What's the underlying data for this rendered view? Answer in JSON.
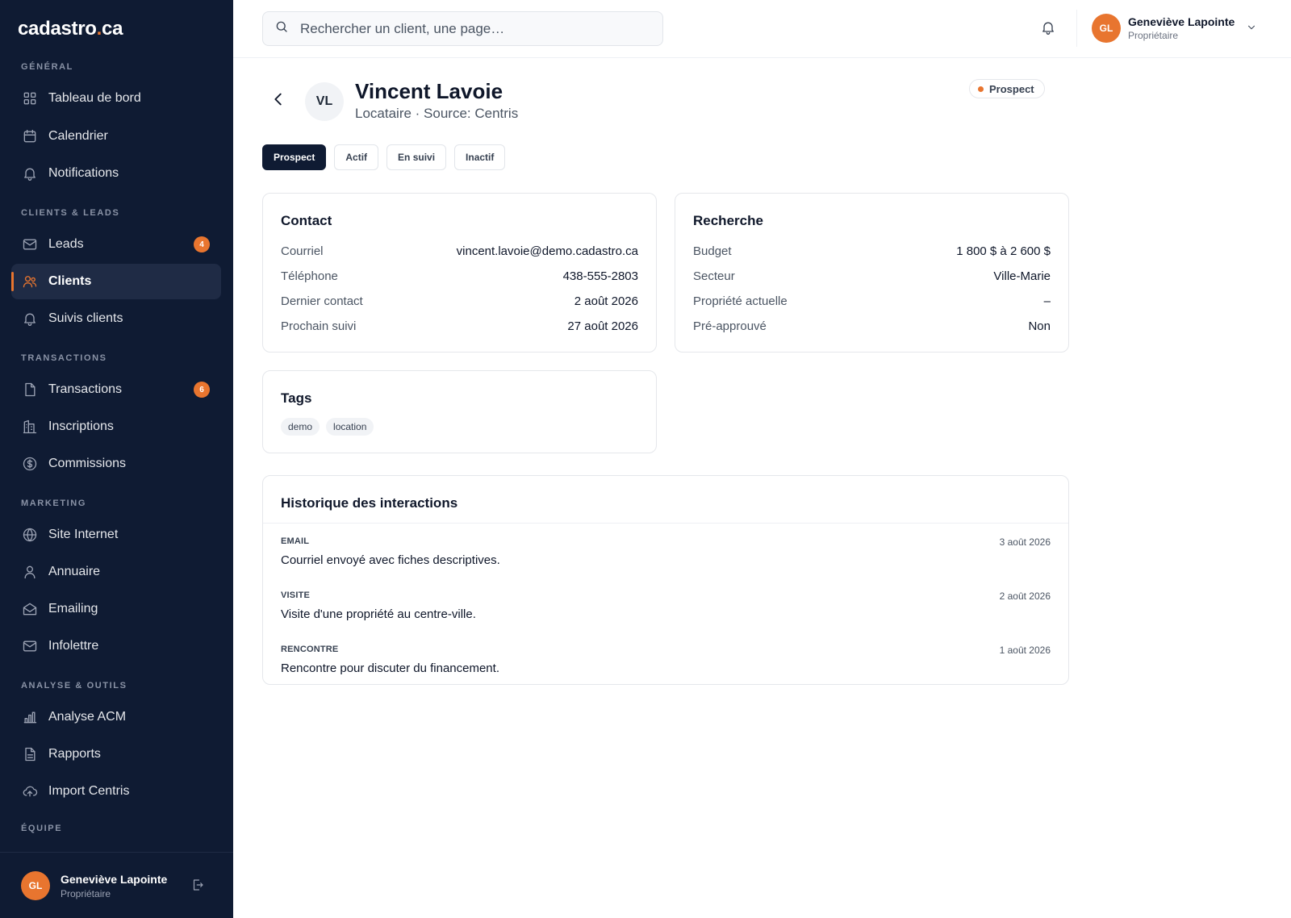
{
  "brand": {
    "name": "cadastro",
    "dot": ".",
    "tld": "ca",
    "accent": "#e8752f",
    "sidebar_bg": "#0f1b33"
  },
  "sidebar": {
    "sections": [
      {
        "label": "GÉNÉRAL"
      },
      {
        "label": "CLIENTS & LEADS"
      },
      {
        "label": "TRANSACTIONS"
      },
      {
        "label": "MARKETING"
      },
      {
        "label": "ANALYSE & OUTILS"
      },
      {
        "label": "ÉQUIPE"
      }
    ],
    "items": [
      {
        "label": "Tableau de bord",
        "icon": "grid-icon"
      },
      {
        "label": "Calendrier",
        "icon": "calendar-icon"
      },
      {
        "label": "Notifications",
        "icon": "bell-icon"
      },
      {
        "label": "Leads",
        "icon": "mail-icon",
        "badge": "4"
      },
      {
        "label": "Clients",
        "icon": "users-icon",
        "active": true
      },
      {
        "label": "Suivis clients",
        "icon": "bell-icon"
      },
      {
        "label": "Transactions",
        "icon": "file-icon",
        "badge": "6"
      },
      {
        "label": "Inscriptions",
        "icon": "building-icon"
      },
      {
        "label": "Commissions",
        "icon": "dollar-icon"
      },
      {
        "label": "Site Internet",
        "icon": "globe-icon"
      },
      {
        "label": "Annuaire",
        "icon": "person-icon"
      },
      {
        "label": "Emailing",
        "icon": "mail-open-icon"
      },
      {
        "label": "Infolettre",
        "icon": "mail-icon"
      },
      {
        "label": "Analyse ACM",
        "icon": "bar-chart-icon"
      },
      {
        "label": "Rapports",
        "icon": "report-icon"
      },
      {
        "label": "Import Centris",
        "icon": "cloud-upload-icon"
      }
    ],
    "user": {
      "initials": "GL",
      "name": "Geneviève Lapointe",
      "role": "Propriétaire"
    }
  },
  "topbar": {
    "search_placeholder": "Rechercher un client, une page…",
    "user": {
      "initials": "GL",
      "name": "Geneviève Lapointe",
      "role": "Propriétaire"
    }
  },
  "client": {
    "initials": "VL",
    "name": "Vincent Lavoie",
    "subtitle": "Locataire · Source: Centris",
    "status": "Prospect",
    "status_tabs": [
      {
        "label": "Prospect",
        "active": true
      },
      {
        "label": "Actif"
      },
      {
        "label": "En suivi"
      },
      {
        "label": "Inactif"
      }
    ]
  },
  "contact": {
    "title": "Contact",
    "rows": [
      {
        "k": "Courriel",
        "v": "vincent.lavoie@demo.cadastro.ca"
      },
      {
        "k": "Téléphone",
        "v": "438-555-2803"
      },
      {
        "k": "Dernier contact",
        "v": "2 août 2026"
      },
      {
        "k": "Prochain suivi",
        "v": "27 août 2026"
      }
    ]
  },
  "recherche": {
    "title": "Recherche",
    "rows": [
      {
        "k": "Budget",
        "v": "1 800 $ à 2 600 $"
      },
      {
        "k": "Secteur",
        "v": "Ville-Marie"
      },
      {
        "k": "Propriété actuelle",
        "v": "–"
      },
      {
        "k": "Pré-approuvé",
        "v": "Non"
      }
    ]
  },
  "tags": {
    "title": "Tags",
    "items": [
      "demo",
      "location"
    ]
  },
  "historique": {
    "title": "Historique des interactions",
    "items": [
      {
        "type": "EMAIL",
        "date": "3 août 2026",
        "text": "Courriel envoyé avec fiches descriptives."
      },
      {
        "type": "VISITE",
        "date": "2 août 2026",
        "text": "Visite d'une propriété au centre-ville."
      },
      {
        "type": "RENCONTRE",
        "date": "1 août 2026",
        "text": "Rencontre pour discuter du financement."
      }
    ]
  }
}
